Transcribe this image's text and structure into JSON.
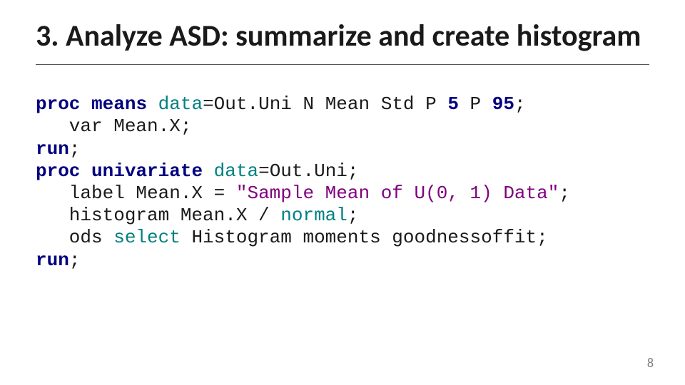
{
  "title": "3.  Analyze ASD: summarize and create histogram",
  "page_num": "8",
  "code": {
    "l1": {
      "a": "proc",
      "b": "means",
      "c": "data",
      "d": "=Out.Uni N Mean Std P",
      "e": "5",
      "f": " P",
      "g": "95",
      "h": ";"
    },
    "l2": {
      "a": "   var Mean.X;"
    },
    "l3": {
      "a": "run",
      "b": ";"
    },
    "l4": {
      "a": "proc",
      "b": "univariate",
      "c": "data",
      "d": "=Out.Uni;"
    },
    "l5": {
      "a": "   label Mean.X = ",
      "b": "\"Sample Mean of U(0, 1) Data\"",
      "c": ";"
    },
    "l6": {
      "a": "   histogram Mean.X / ",
      "b": "normal",
      "c": ";"
    },
    "l7": {
      "a": "   ods ",
      "b": "select",
      "c": " Histogram moments goodnessoffit;"
    },
    "l8": {
      "a": "run",
      "b": ";"
    }
  }
}
